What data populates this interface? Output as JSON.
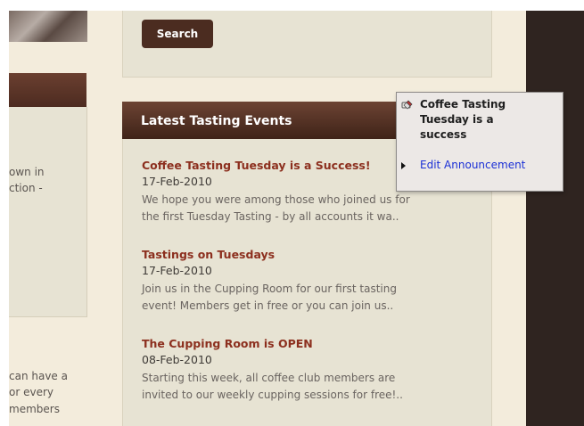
{
  "left_column": {
    "text_1": [
      "own in",
      "ction -"
    ],
    "text_2": [
      "can have a",
      "or every",
      "members"
    ]
  },
  "search": {
    "button_label": "Search"
  },
  "events": {
    "title": "Latest Tasting Events",
    "items": [
      {
        "title": "Coffee Tasting Tuesday is a Success!",
        "date": "17-Feb-2010",
        "lines": [
          "We hope you were among those who joined us for",
          "the first Tuesday Tasting - by all accounts it wa.."
        ]
      },
      {
        "title": "Tastings on Tuesdays",
        "date": "17-Feb-2010",
        "lines": [
          "Join us in the Cupping Room for our first tasting",
          "event! Members get in free or you can join us.."
        ]
      },
      {
        "title": "The Cupping Room is OPEN",
        "date": "08-Feb-2010",
        "lines": [
          "Starting this week, all coffee club members are",
          "invited to our weekly cupping sessions for free!.."
        ]
      }
    ]
  },
  "popup": {
    "title_lines": [
      "Coffee Tasting",
      "Tuesday is a",
      "success"
    ],
    "action": "Edit Announcement",
    "icon": "pencil-edit-icon"
  },
  "colors": {
    "page_background": "#f3ecdc",
    "panel_background": "#e7e3d3",
    "header_brown": "#4b2c20",
    "event_title": "#8c2f1e",
    "link_blue": "#1a2fd6",
    "dark_sidebar": "#2f2420"
  }
}
